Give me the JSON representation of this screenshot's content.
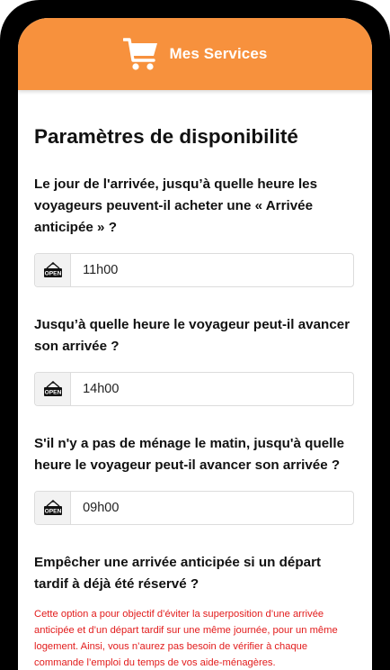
{
  "header": {
    "title": "Mes Services",
    "icon": "cart-icon",
    "color": "#f7913d"
  },
  "page": {
    "title": "Paramètres de disponibilité"
  },
  "settings": [
    {
      "question": "Le jour de l'arrivée, jusqu’à quelle heure les voyageurs peuvent-il acheter une « Arrivée anticipée » ?",
      "value": "11h00",
      "icon": "open-sign-icon"
    },
    {
      "question": "Jusqu’à quelle heure le voyageur peut-il avancer son arrivée ?",
      "value": "14h00",
      "icon": "open-sign-icon"
    },
    {
      "question": "S'il n'y a pas de ménage le matin, jusqu'à quelle heure le voyageur peut-il avancer son arrivée ?",
      "value": "09h00",
      "icon": "open-sign-icon"
    }
  ],
  "prevent": {
    "question": "Empêcher une arrivée anticipée si un départ tardif à déjà été réservé ?",
    "note": "Cette option a pour objectif d’éviter la superposition d’une arrivée anticipée et d’un départ tardif sur une même journée, pour un même logement. Ainsi, vous n’aurez pas besoin de vérifier à chaque commande l’emploi du temps de vos aide-ménagères.",
    "note_color": "#e21b1b"
  },
  "sign_label": "OPEN"
}
